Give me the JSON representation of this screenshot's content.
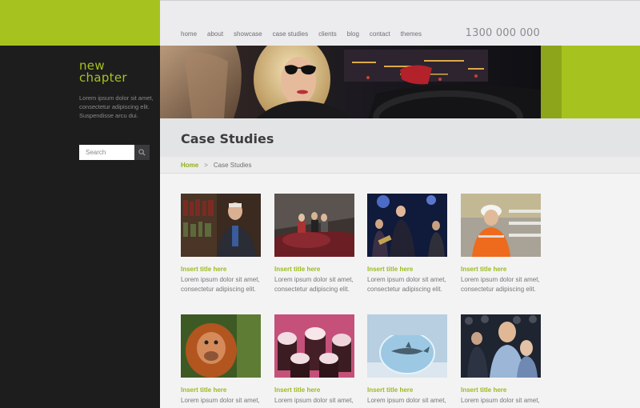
{
  "brand": {
    "line1": "new",
    "line2": "chapter"
  },
  "sidebar": {
    "tagline": "Lorem ipsum dolor sit amet, consectetur adipiscing elit. Suspendisse arcu dui.",
    "search_placeholder": "Search"
  },
  "nav": {
    "items": [
      "home",
      "about",
      "showcase",
      "case studies",
      "clients",
      "blog",
      "contact",
      "themes"
    ]
  },
  "phone": "1300 000 000",
  "page": {
    "title": "Case Studies",
    "breadcrumb_home": "Home",
    "breadcrumb_sep": ">",
    "breadcrumb_current": "Case Studies"
  },
  "cards": [
    {
      "title": "Insert title here",
      "text": "Lorem ipsum dolor sit amet, consectetur adipiscing elit."
    },
    {
      "title": "Insert title here",
      "text": "Lorem ipsum dolor sit amet, consectetur adipiscing elit."
    },
    {
      "title": "Insert title here",
      "text": "Lorem ipsum dolor sit amet, consectetur adipiscing elit."
    },
    {
      "title": "Insert title here",
      "text": "Lorem ipsum dolor sit amet, consectetur adipiscing elit."
    },
    {
      "title": "Insert title here",
      "text": "Lorem ipsum dolor sit amet,"
    },
    {
      "title": "Insert title here",
      "text": "Lorem ipsum dolor sit amet,"
    },
    {
      "title": "Insert title here",
      "text": "Lorem ipsum dolor sit amet,"
    },
    {
      "title": "Insert title here",
      "text": "Lorem ipsum dolor sit amet,"
    }
  ],
  "colors": {
    "accent": "#a6c21f",
    "sidebar": "#1d1d1e",
    "link_title": "#9cbb1e"
  }
}
